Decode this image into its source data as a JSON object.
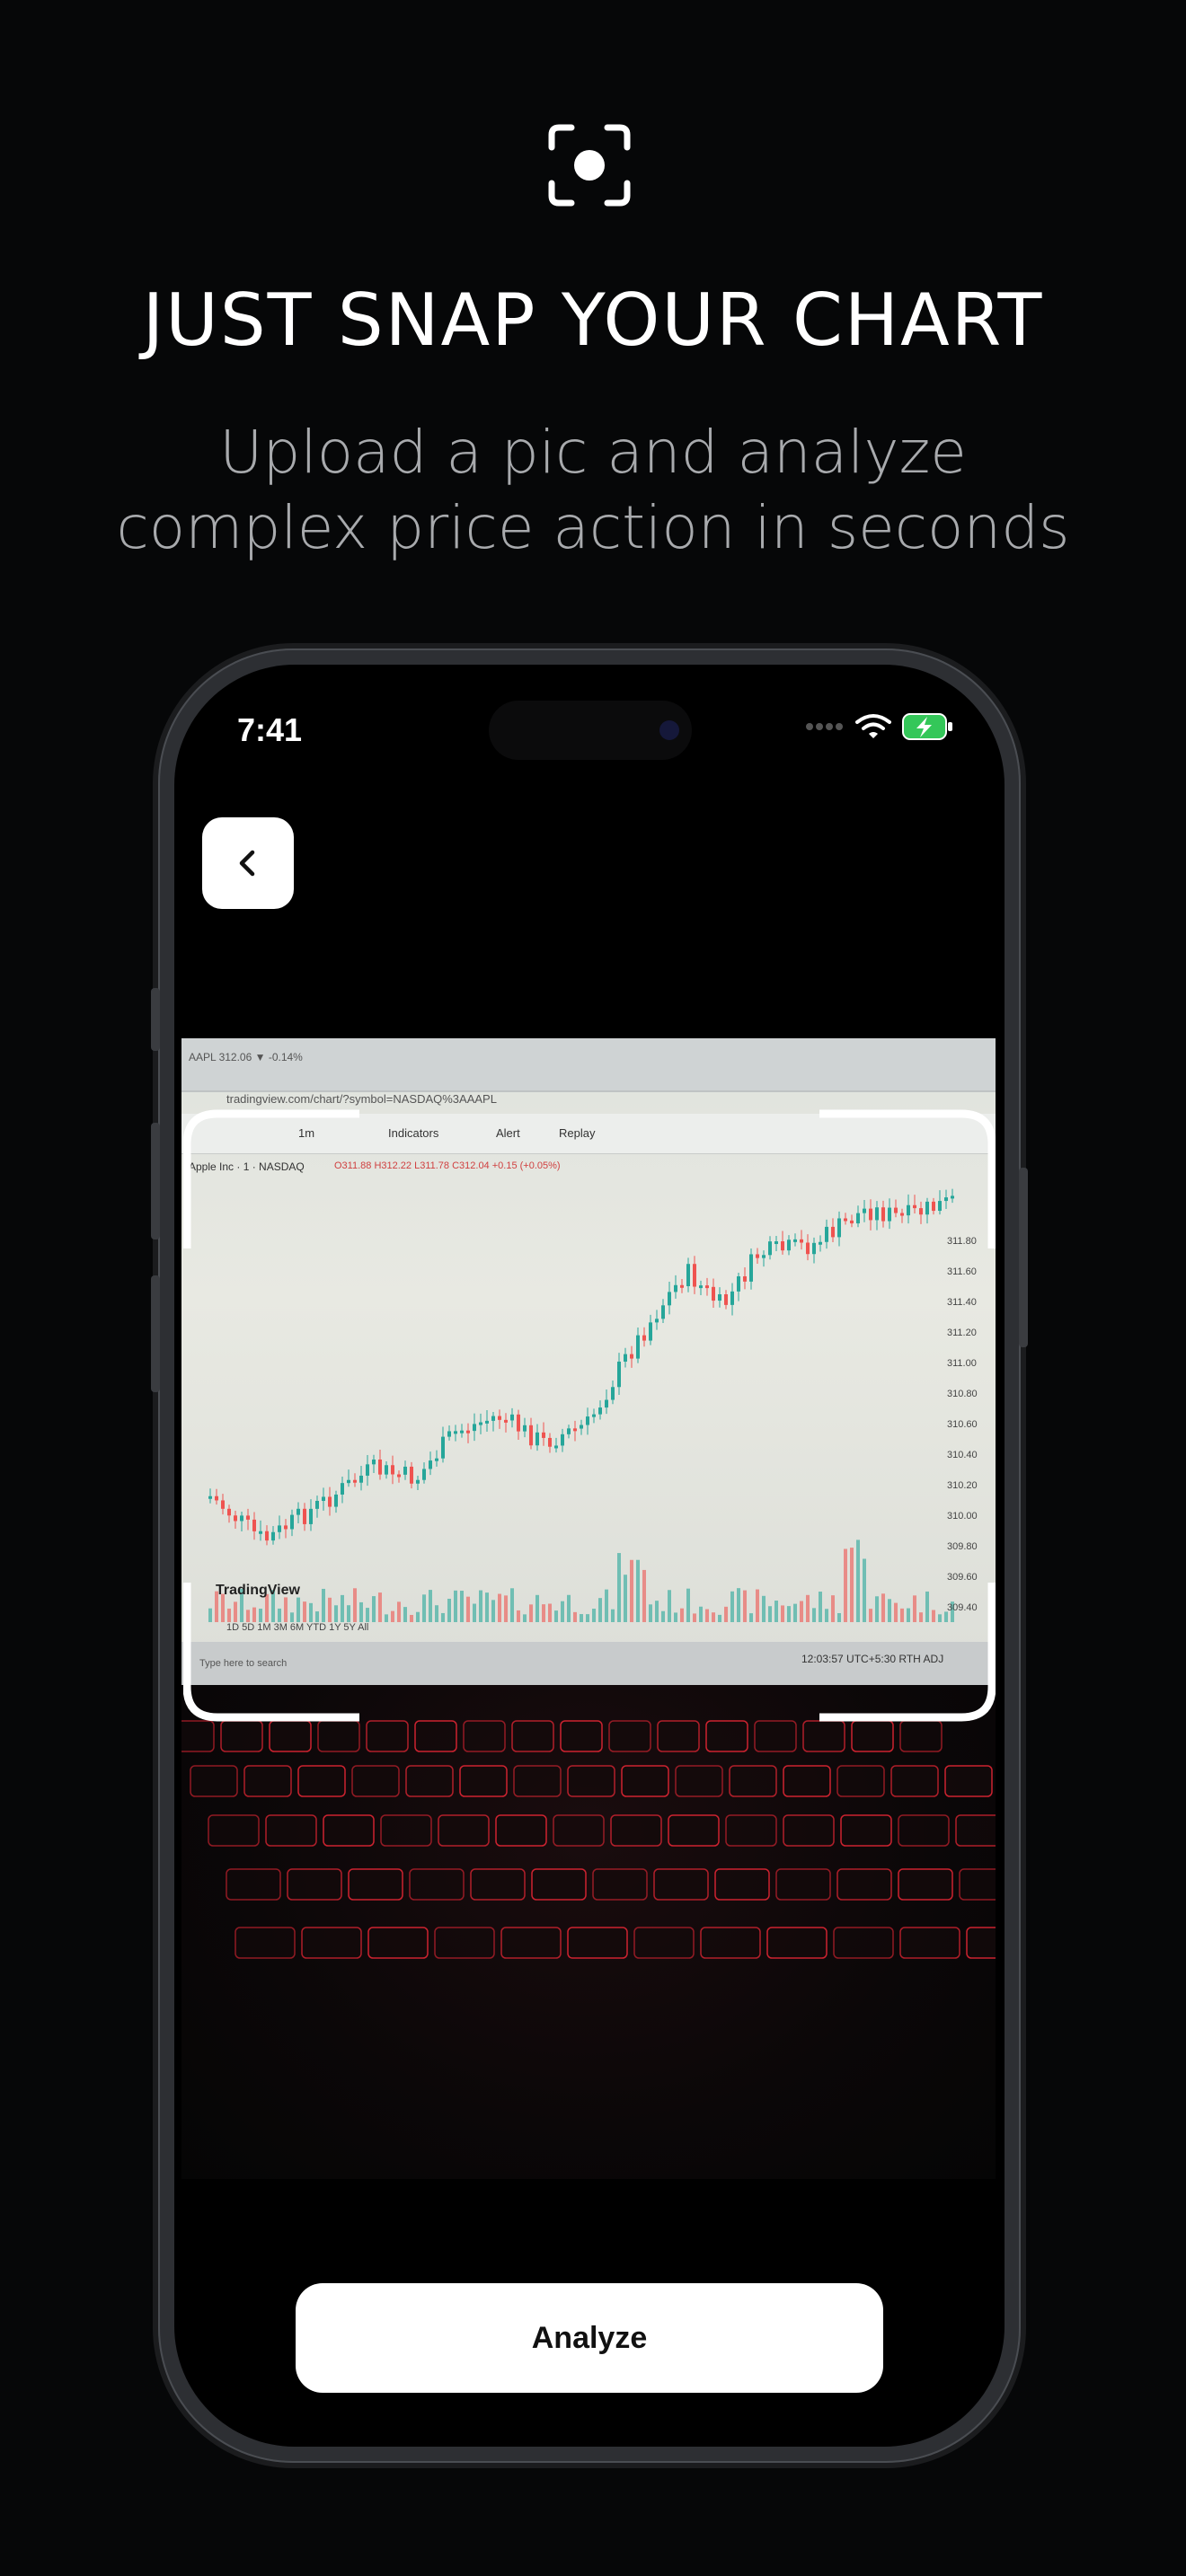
{
  "header": {
    "headline": "JUST SNAP YOUR CHART",
    "subline_1": "Upload a pic and analyze",
    "subline_2": "complex price action in seconds",
    "icon": "camera-focus-icon"
  },
  "status_bar": {
    "time": "7:41",
    "icons": [
      "wifi-icon",
      "battery-charging-icon"
    ]
  },
  "nav": {
    "back_icon": "chevron-left-icon"
  },
  "photo": {
    "tab_title": "AAPL 312.06 ▼ -0.14%",
    "url": "tradingview.com/chart/?symbol=NASDAQ%3AAAPL",
    "symbol": "Apple Inc · 1 · NASDAQ",
    "ohlc": "O311.88 H312.22 L311.78 C312.04 +0.15 (+0.05%)",
    "toolbar": [
      "1m",
      "Indicators",
      "Alert",
      "Replay"
    ],
    "logo": "TradingView",
    "ranges": "1D  5D  1M  3M  6M  YTD  1Y  5Y  All",
    "timezone": "12:03:57 UTC+5:30  RTH  ADJ",
    "search_placeholder": "Type here to search",
    "price_labels": [
      "311.80",
      "311.60",
      "311.40",
      "311.20",
      "311.00",
      "310.80",
      "310.60",
      "310.40",
      "310.20",
      "310.00",
      "309.80",
      "309.60",
      "309.40"
    ]
  },
  "actions": {
    "analyze_label": "Analyze"
  },
  "colors": {
    "background": "#060708",
    "candle_up": "#26a69a",
    "candle_down": "#ef5350",
    "button_bg": "#ffffff",
    "keyboard_glow": "#ff2a3a"
  }
}
